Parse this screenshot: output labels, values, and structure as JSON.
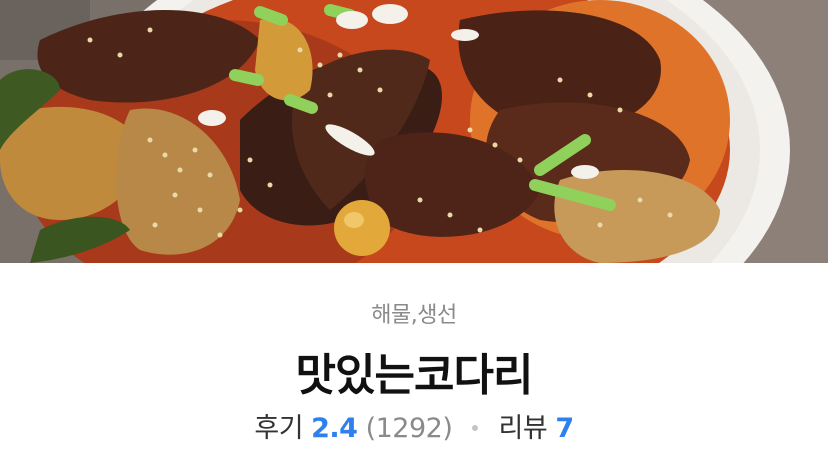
{
  "recipe": {
    "category": "해물,생선",
    "title": "맛있는코다리",
    "review_label": "후기",
    "rating": "2.4",
    "rating_count": "(1292)",
    "comment_label": "리뷰",
    "comment_count": "7"
  },
  "colors": {
    "accent": "#2f80ed",
    "category_text": "#8a8a8a",
    "title_text": "#111111"
  }
}
